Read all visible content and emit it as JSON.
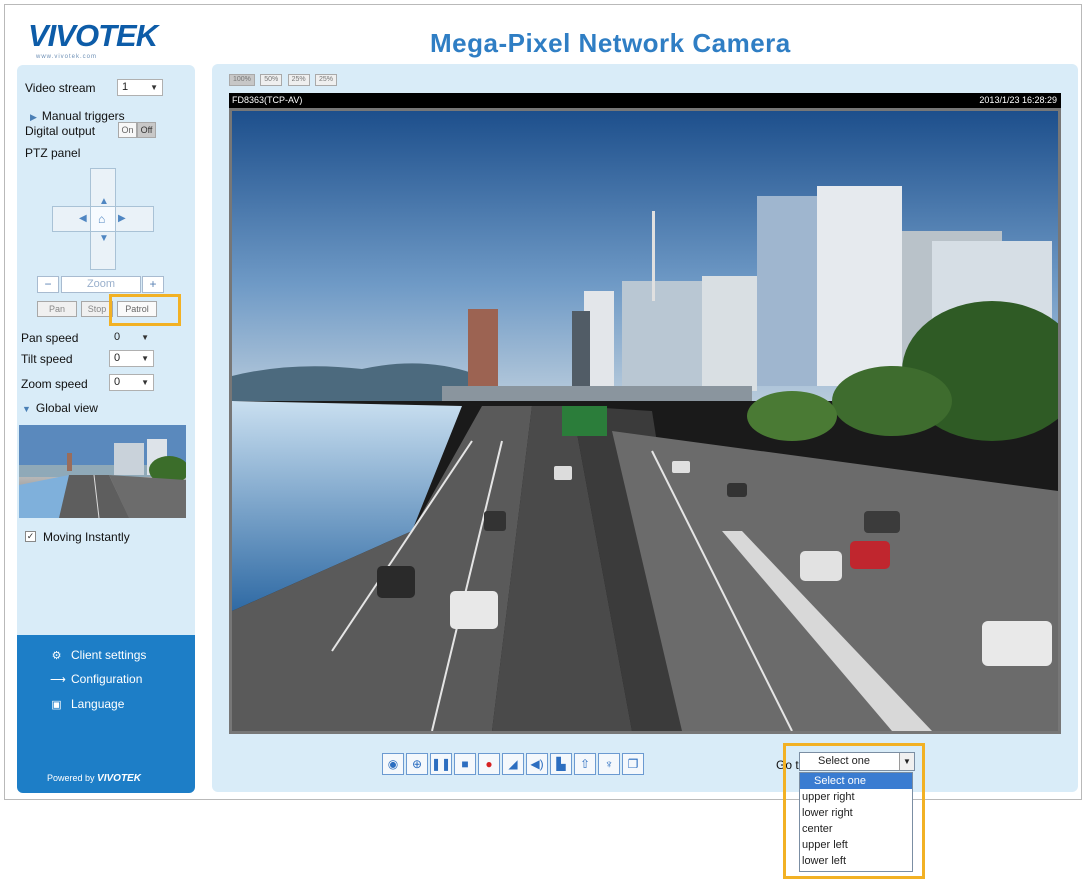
{
  "app": {
    "logo_text": "VIVOTEK",
    "logo_sub": "www.vivotek.com",
    "title": "Mega-Pixel Network Camera"
  },
  "sidebar": {
    "video_stream_label": "Video stream",
    "video_stream_value": "1",
    "manual_triggers_label": "Manual triggers",
    "digital_output_label": "Digital output",
    "digital_output_on": "On",
    "digital_output_off": "Off",
    "ptz_panel_label": "PTZ panel",
    "zoom_label": "Zoom",
    "zoom_minus": "−",
    "zoom_plus": "+",
    "pan_button": "Pan",
    "stop_button": "Stop",
    "patrol_button": "Patrol",
    "pan_speed_label": "Pan speed",
    "pan_speed_value": "0",
    "tilt_speed_label": "Tilt speed",
    "tilt_speed_value": "0",
    "zoom_speed_label": "Zoom speed",
    "zoom_speed_value": "0",
    "global_view_label": "Global view",
    "moving_instantly_label": "Moving Instantly",
    "moving_instantly_checked": true
  },
  "bottom_menu": {
    "client_settings": "Client settings",
    "configuration": "Configuration",
    "language": "Language",
    "powered_by": "Powered by",
    "powered_brand": "VIVOTEK"
  },
  "view": {
    "tabs": [
      "100%",
      "50%",
      "25%",
      "25%"
    ],
    "camera_name": "FD8363(TCP-AV)",
    "timestamp": "2013/1/23 16:28:29"
  },
  "toolbar": {
    "icons": [
      "camera-icon",
      "zoom-icon",
      "pause-icon",
      "stop-icon",
      "record-icon",
      "mute-icon",
      "speaker-icon",
      "save-icon",
      "upload-icon",
      "microphone-icon",
      "window-icon"
    ],
    "goto_label": "Go to",
    "goto_selected": "Select one",
    "goto_options": [
      "Select one",
      "upper right",
      "lower right",
      "center",
      "upper left",
      "lower left"
    ]
  },
  "colors": {
    "accent": "#2f7ec4",
    "panel_bg": "#d9ecf8",
    "bottom_menu_bg": "#1d7ec7",
    "highlight": "#f2b124"
  }
}
